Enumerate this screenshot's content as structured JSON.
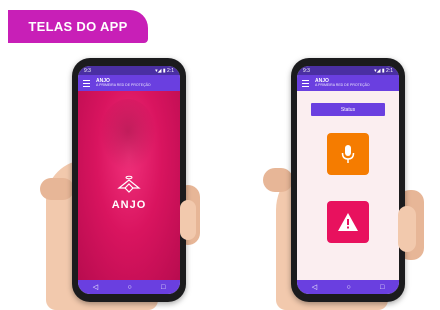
{
  "banner": {
    "label": "TELAS DO APP"
  },
  "phones": {
    "left": {
      "statusbar": {
        "left": "9:3",
        "right": "▾◢ ▮ 2:1"
      },
      "appbar": {
        "title": "ANJO",
        "subtitle": "A PRIMEIRA RED DE PROTEÇÃO"
      },
      "logo_text": "ANJO",
      "nav": {
        "back": "◁",
        "home": "○",
        "recent": "□"
      }
    },
    "right": {
      "statusbar": {
        "left": "9:3",
        "right": "▾◢ ▮ 2:1"
      },
      "appbar": {
        "title": "ANJO",
        "subtitle": "A PRIMEIRA RED DE PROTEÇÃO"
      },
      "status_button": "Status",
      "mic_icon": "microphone-icon",
      "alert_icon": "warning-icon",
      "nav": {
        "back": "◁",
        "home": "○",
        "recent": "□"
      }
    }
  },
  "colors": {
    "banner": "#c81fb7",
    "appbar": "#6a3fe0",
    "splash": "#d9145f",
    "mic_button": "#f57c00",
    "alert_button": "#e8115e",
    "home_bg": "#fbeef0"
  }
}
